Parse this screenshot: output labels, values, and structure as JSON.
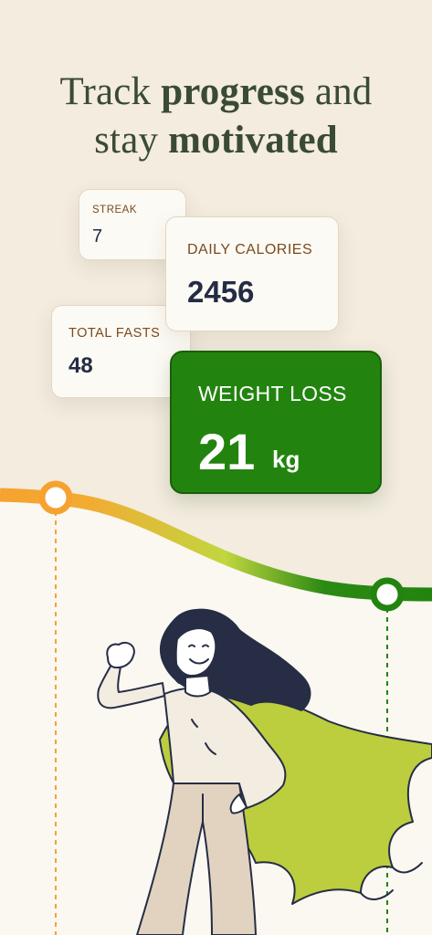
{
  "headline": {
    "line1_pre": "Track ",
    "line1_bold": "progress",
    "line1_post": " and",
    "line2_pre": "stay ",
    "line2_bold": "motivated"
  },
  "stats": {
    "streak": {
      "label": "STREAK",
      "value": "7"
    },
    "total_fasts": {
      "label": "TOTAL FASTS",
      "value": "48"
    },
    "daily_calories": {
      "label": "DAILY CALORIES",
      "value": "2456"
    },
    "weight_loss": {
      "label": "WEIGHT LOSS",
      "value": "21",
      "unit": "kg"
    }
  },
  "colors": {
    "background": "#f3ecdf",
    "headline": "#3a4a36",
    "accent_green": "#22840f",
    "curve_start": "#f6a230",
    "curve_mid": "#c2d63f",
    "curve_end": "#22840f",
    "cape": "#bccd3e",
    "hair": "#262d45"
  }
}
